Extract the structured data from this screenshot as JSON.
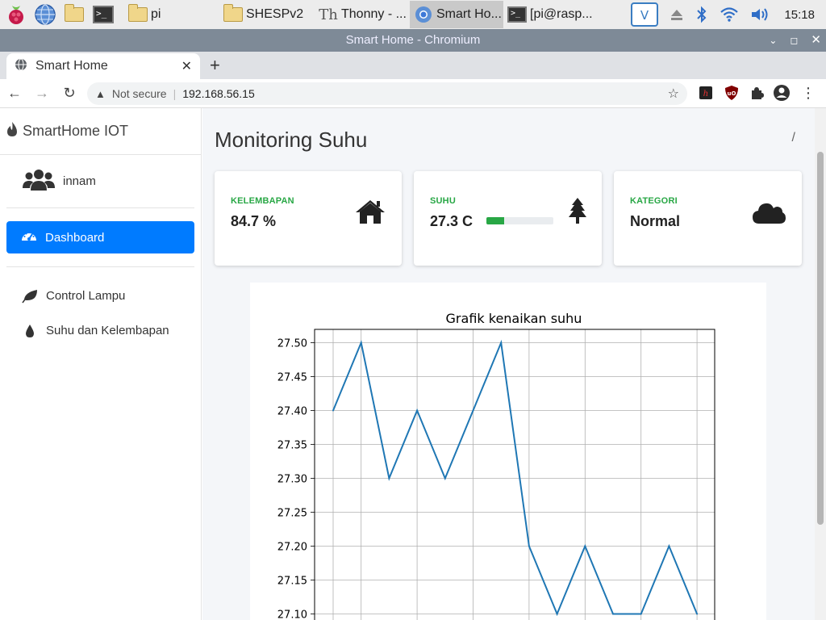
{
  "taskbar": {
    "tasks": [
      {
        "label": "pi"
      },
      {
        "label": "SHESPv2"
      },
      {
        "label": "Thonny  - ..."
      },
      {
        "label": "Smart Ho..."
      },
      {
        "label": "[pi@rasp..."
      }
    ],
    "clock": "15:18"
  },
  "window": {
    "title": "Smart Home - Chromium"
  },
  "browser": {
    "tab_title": "Smart Home",
    "security_label": "Not secure",
    "url": "192.168.56.15"
  },
  "sidebar": {
    "brand": "SmartHome IOT",
    "username": "innam",
    "active_item": "Dashboard",
    "items": [
      {
        "label": "Control Lampu"
      },
      {
        "label": "Suhu dan Kelembapan"
      }
    ]
  },
  "page": {
    "title": "Monitoring Suhu",
    "breadcrumb": "/"
  },
  "cards": {
    "humidity": {
      "label": "KELEMBAPAN",
      "value": "84.7 %"
    },
    "temperature": {
      "label": "SUHU",
      "value": "27.3 C",
      "progress_percent": 27
    },
    "category": {
      "label": "KATEGORI",
      "value": "Normal"
    }
  },
  "colors": {
    "primary": "#007bff",
    "success": "#28a745",
    "line": "#1f77b4"
  },
  "chart_data": {
    "type": "line",
    "title": "Grafik kenaikan suhu",
    "x": [
      0,
      1,
      2,
      3,
      4,
      5,
      6,
      7,
      8,
      9,
      10,
      11,
      12,
      13
    ],
    "values": [
      27.4,
      27.5,
      27.3,
      27.4,
      27.3,
      27.4,
      27.5,
      27.2,
      27.1,
      27.2,
      27.1,
      27.1,
      27.2,
      27.1
    ],
    "yticks": [
      "27.50",
      "27.45",
      "27.40",
      "27.35",
      "27.30",
      "27.25",
      "27.20",
      "27.15",
      "27.10"
    ],
    "ytick_values": [
      27.5,
      27.45,
      27.4,
      27.35,
      27.3,
      27.25,
      27.2,
      27.15,
      27.1
    ],
    "grid": true,
    "xlabel": "",
    "ylabel": ""
  }
}
